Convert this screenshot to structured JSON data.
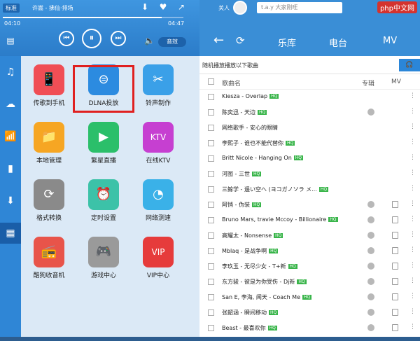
{
  "player": {
    "mode": "标准",
    "song": "许嵩 - 拂仙·排场",
    "time_current": "04:10",
    "time_total": "04:47",
    "progress": 0.88,
    "volume_label": "音效"
  },
  "sidebar": {
    "items": [
      {
        "icon": "music-note-icon",
        "glyph": "♫"
      },
      {
        "icon": "cloud-icon",
        "glyph": "☁"
      },
      {
        "icon": "broadcast-icon",
        "glyph": "📶"
      },
      {
        "icon": "mobile-icon",
        "glyph": "▮"
      },
      {
        "icon": "download-icon",
        "glyph": "⬇"
      },
      {
        "icon": "apps-icon",
        "glyph": "▦"
      }
    ]
  },
  "apps": [
    {
      "label": "传歌到手机",
      "color": "#f04e55",
      "glyph": "📱"
    },
    {
      "label": "DLNA投放",
      "color": "#2c8be0",
      "glyph": "⊜"
    },
    {
      "label": "铃声制作",
      "color": "#3aa0e8",
      "glyph": "✂"
    },
    {
      "label": "本地管理",
      "color": "#f6a623",
      "glyph": "📁"
    },
    {
      "label": "繁星直播",
      "color": "#2bbf6a",
      "glyph": "▶"
    },
    {
      "label": "在线KTV",
      "color": "#c63fd1",
      "glyph": "KTV"
    },
    {
      "label": "格式转换",
      "color": "#8a8a8a",
      "glyph": "⟳"
    },
    {
      "label": "定时设置",
      "color": "#3cc2a8",
      "glyph": "⏰"
    },
    {
      "label": "网络测速",
      "color": "#3ab1e8",
      "glyph": "◔"
    },
    {
      "label": "酷狗收音机",
      "color": "#e8544a",
      "glyph": "📻"
    },
    {
      "label": "游戏中心",
      "color": "#9a9a9a",
      "glyph": "🎮"
    },
    {
      "label": "VIP中心",
      "color": "#e63b3b",
      "glyph": "VIP"
    }
  ],
  "header": {
    "user_label": "关人",
    "search_placeholder": "t.a.y 大家刚旺",
    "tabs": [
      "乐库",
      "电台",
      "MV"
    ],
    "watermark": "php中文网"
  },
  "list": {
    "subtitle": "随机播放播放以下歌曲",
    "columns": [
      "歌曲名",
      "专辑",
      "MV"
    ],
    "rows": [
      {
        "name": "Kiesza - Overlap",
        "hq": true,
        "album": false,
        "mv": false
      },
      {
        "name": "陈奕迅 - 天边",
        "hq": true,
        "album": true,
        "mv": false
      },
      {
        "name": "网络歌手 - 安心的眼睛",
        "hq": false,
        "album": false,
        "mv": false
      },
      {
        "name": "李熙子 - 谁也不能代替你",
        "hq": true,
        "album": false,
        "mv": false
      },
      {
        "name": "Britt Nicole - Hanging On",
        "hq": true,
        "album": false,
        "mv": false
      },
      {
        "name": "河图 - 三世",
        "hq": true,
        "album": false,
        "mv": false
      },
      {
        "name": "三鲸学 - 遥い空へ (ヨコガノソラ メ...",
        "hq": true,
        "album": false,
        "mv": false
      },
      {
        "name": "阿悄 - 伪装",
        "hq": true,
        "album": true,
        "mv": true
      },
      {
        "name": "Bruno Mars, travie Mccoy - Billionaire",
        "hq": true,
        "album": true,
        "mv": true
      },
      {
        "name": "高耀太 - Nonsense",
        "hq": true,
        "album": true,
        "mv": true
      },
      {
        "name": "Mblaq - 是战争啊",
        "hq": true,
        "album": true,
        "mv": true
      },
      {
        "name": "李玖玉 - 无尽少女 - T+新",
        "hq": true,
        "album": true,
        "mv": true
      },
      {
        "name": "东方骏 - 彼是为你受伤 - Dj新",
        "hq": true,
        "album": true,
        "mv": true
      },
      {
        "name": "San E, 李海, 闻天 - Coach Me",
        "hq": true,
        "album": true,
        "mv": true
      },
      {
        "name": "张韶涵 - 瞬间移动",
        "hq": true,
        "album": true,
        "mv": true
      },
      {
        "name": "Beast - 最喜欢你",
        "hq": true,
        "album": true,
        "mv": true
      }
    ]
  }
}
